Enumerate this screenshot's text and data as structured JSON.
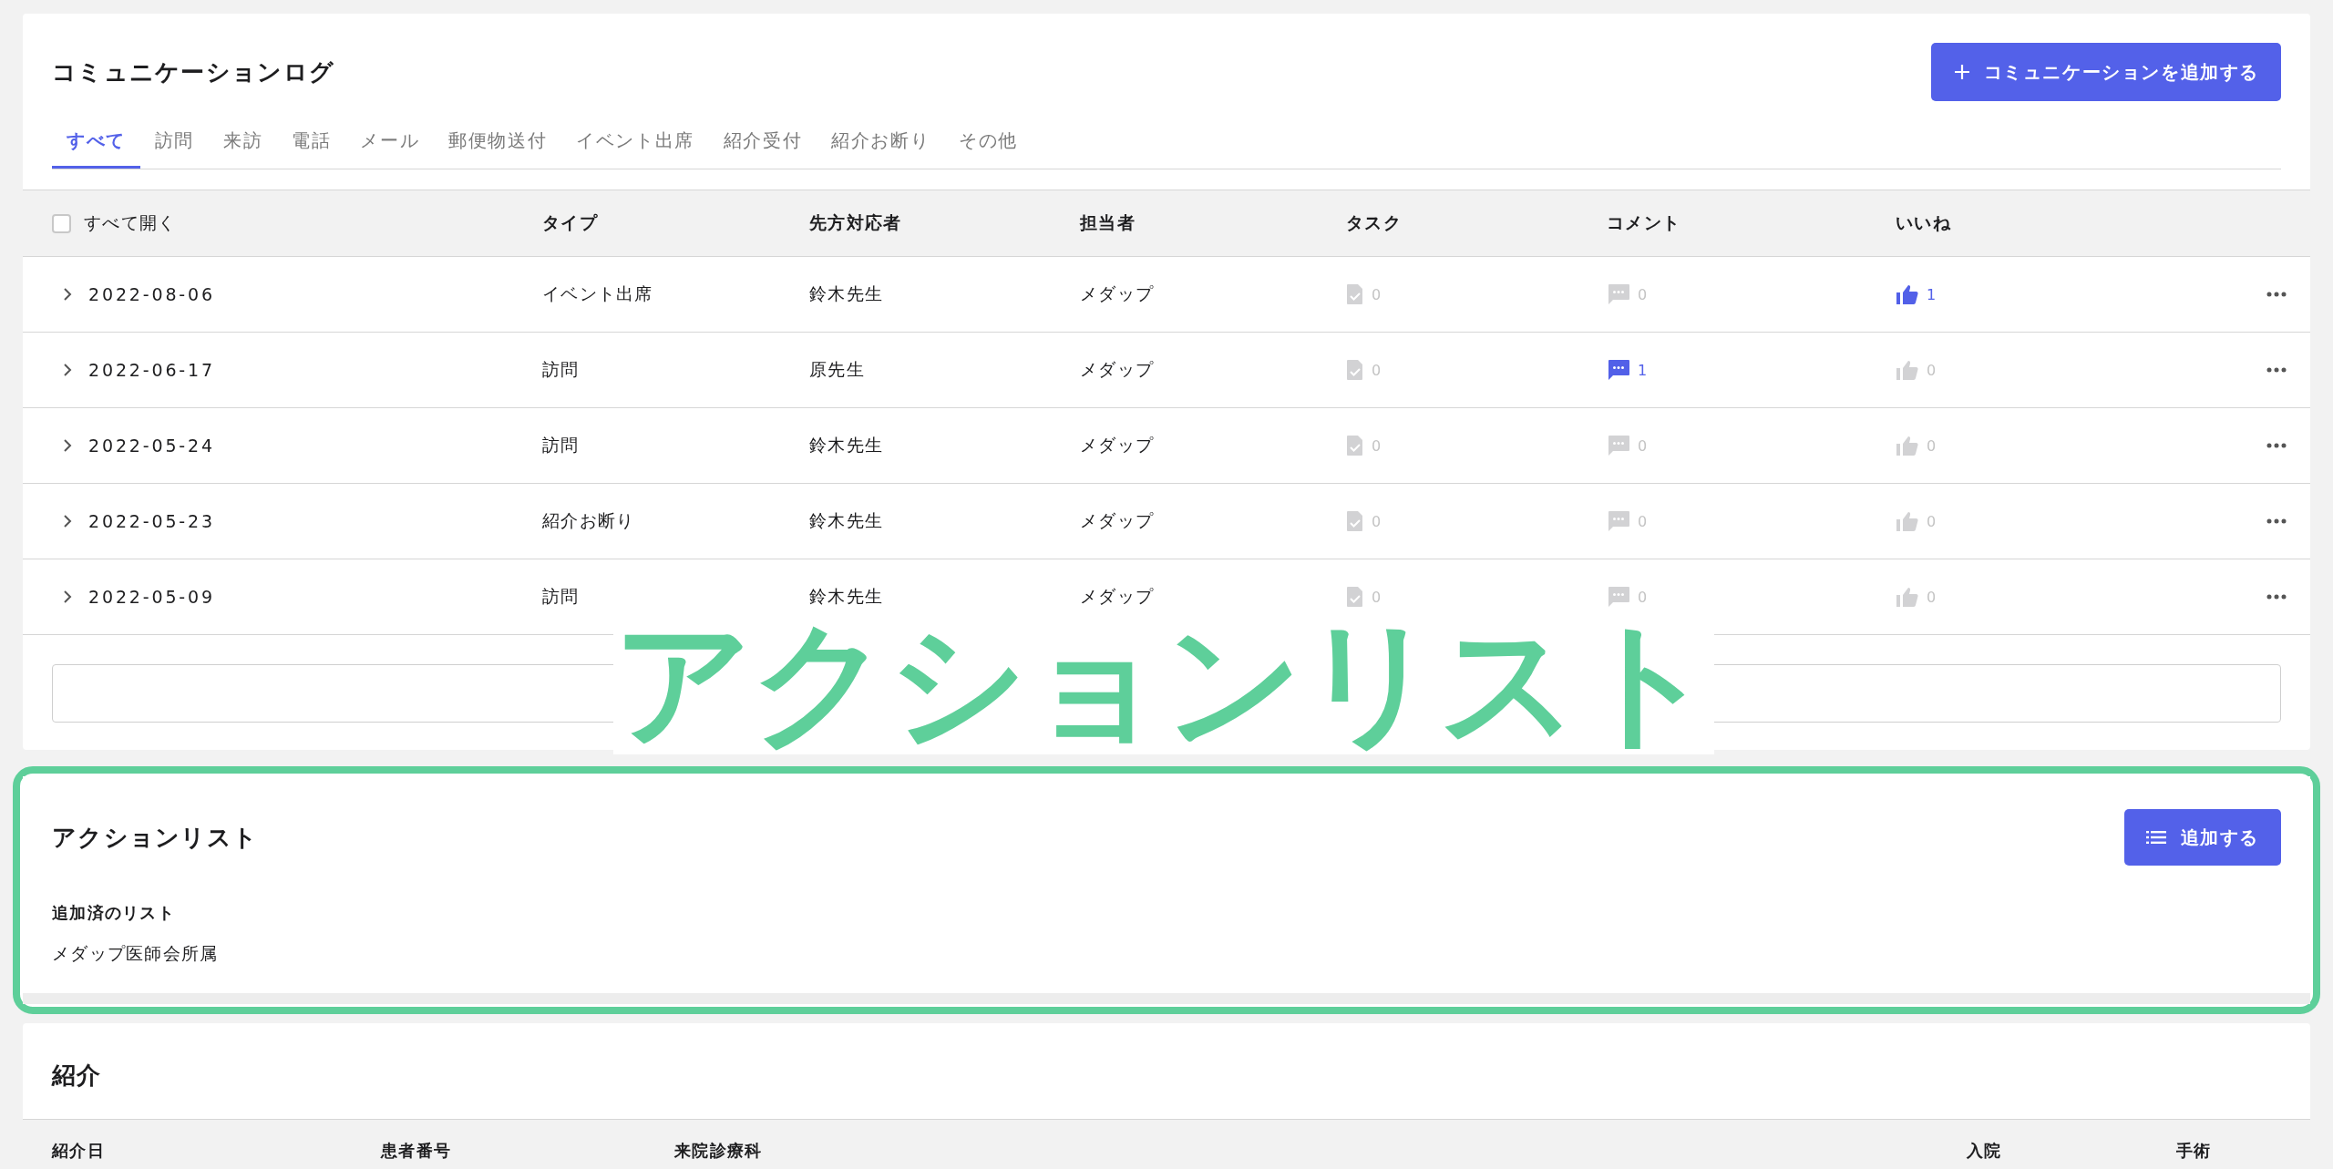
{
  "communication_log": {
    "title": "コミュニケーションログ",
    "add_button": "コミュニケーションを追加する",
    "tabs": [
      {
        "label": "すべて",
        "selected": true
      },
      {
        "label": "訪問",
        "selected": false
      },
      {
        "label": "来訪",
        "selected": false
      },
      {
        "label": "電話",
        "selected": false
      },
      {
        "label": "メール",
        "selected": false
      },
      {
        "label": "郵便物送付",
        "selected": false
      },
      {
        "label": "イベント出席",
        "selected": false
      },
      {
        "label": "紹介受付",
        "selected": false
      },
      {
        "label": "紹介お断り",
        "selected": false
      },
      {
        "label": "その他",
        "selected": false
      }
    ],
    "expand_all": {
      "label": "すべて開く",
      "checked": false
    },
    "columns": [
      "タイプ",
      "先方対応者",
      "担当者",
      "タスク",
      "コメント",
      "いいね"
    ],
    "rows": [
      {
        "date": "2022-08-06",
        "type": "イベント出席",
        "contact": "鈴木先生",
        "owner": "メダップ",
        "tasks": {
          "count": "0",
          "active": false
        },
        "comments": {
          "count": "0",
          "active": false
        },
        "likes": {
          "count": "1",
          "active": true
        }
      },
      {
        "date": "2022-06-17",
        "type": "訪問",
        "contact": "原先生",
        "owner": "メダップ",
        "tasks": {
          "count": "0",
          "active": false
        },
        "comments": {
          "count": "1",
          "active": true
        },
        "likes": {
          "count": "0",
          "active": false
        }
      },
      {
        "date": "2022-05-24",
        "type": "訪問",
        "contact": "鈴木先生",
        "owner": "メダップ",
        "tasks": {
          "count": "0",
          "active": false
        },
        "comments": {
          "count": "0",
          "active": false
        },
        "likes": {
          "count": "0",
          "active": false
        }
      },
      {
        "date": "2022-05-23",
        "type": "紹介お断り",
        "contact": "鈴木先生",
        "owner": "メダップ",
        "tasks": {
          "count": "0",
          "active": false
        },
        "comments": {
          "count": "0",
          "active": false
        },
        "likes": {
          "count": "0",
          "active": false
        }
      },
      {
        "date": "2022-05-09",
        "type": "訪問",
        "contact": "鈴木先生",
        "owner": "メダップ",
        "tasks": {
          "count": "0",
          "active": false
        },
        "comments": {
          "count": "0",
          "active": false
        },
        "likes": {
          "count": "0",
          "active": false
        }
      }
    ]
  },
  "annotation": {
    "text": "アクションリスト"
  },
  "action_list": {
    "title": "アクションリスト",
    "add_button": "追加する",
    "subtitle": "追加済のリスト",
    "items": [
      "メダップ医師会所属"
    ]
  },
  "referrals": {
    "title": "紹介",
    "columns": [
      "紹介日",
      "患者番号",
      "来院診療科",
      "入院",
      "手術"
    ]
  }
}
